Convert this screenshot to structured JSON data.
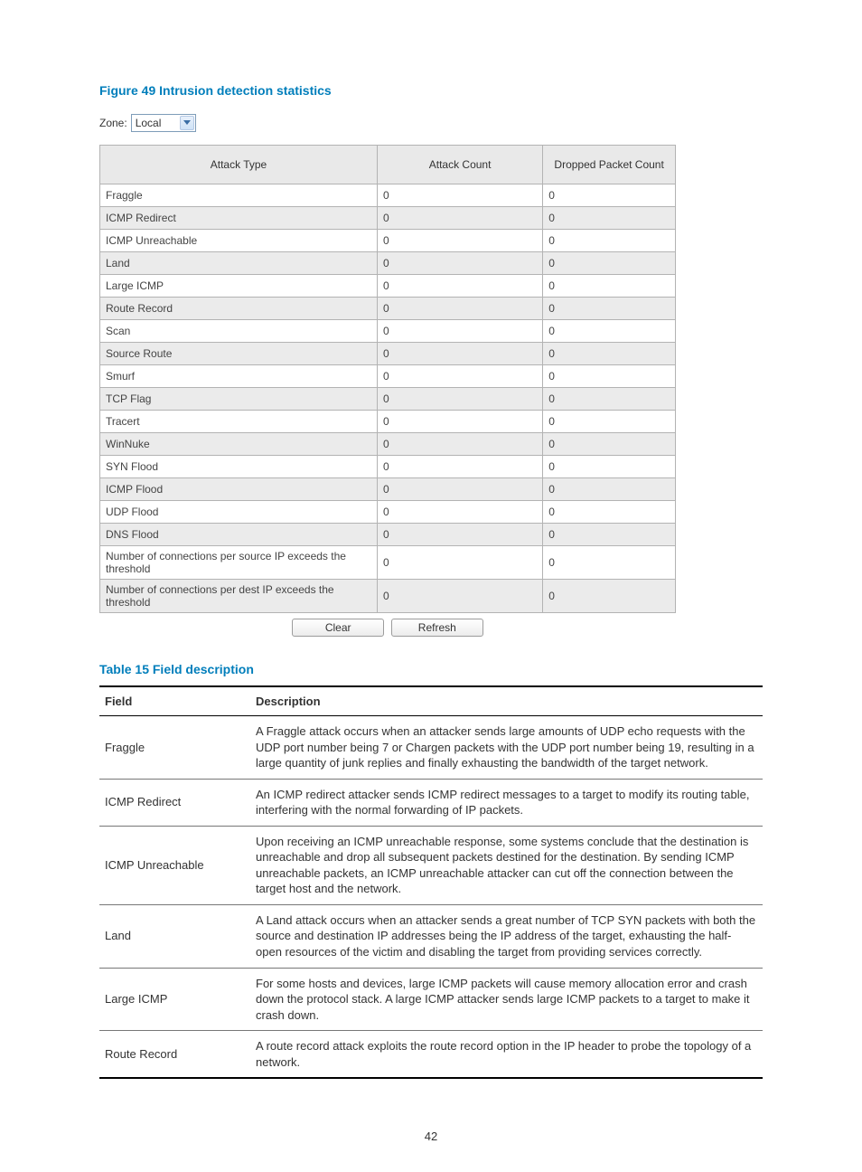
{
  "figure_title": "Figure 49 Intrusion detection statistics",
  "zone_label": "Zone:",
  "zone_value": "Local",
  "stats_headers": {
    "type": "Attack Type",
    "count": "Attack Count",
    "drop": "Dropped Packet Count"
  },
  "stats_rows": [
    {
      "type": "Fraggle",
      "count": "0",
      "drop": "0"
    },
    {
      "type": "ICMP Redirect",
      "count": "0",
      "drop": "0"
    },
    {
      "type": "ICMP Unreachable",
      "count": "0",
      "drop": "0"
    },
    {
      "type": "Land",
      "count": "0",
      "drop": "0"
    },
    {
      "type": "Large ICMP",
      "count": "0",
      "drop": "0"
    },
    {
      "type": "Route Record",
      "count": "0",
      "drop": "0"
    },
    {
      "type": "Scan",
      "count": "0",
      "drop": "0"
    },
    {
      "type": "Source Route",
      "count": "0",
      "drop": "0"
    },
    {
      "type": "Smurf",
      "count": "0",
      "drop": "0"
    },
    {
      "type": "TCP Flag",
      "count": "0",
      "drop": "0"
    },
    {
      "type": "Tracert",
      "count": "0",
      "drop": "0"
    },
    {
      "type": "WinNuke",
      "count": "0",
      "drop": "0"
    },
    {
      "type": "SYN Flood",
      "count": "0",
      "drop": "0"
    },
    {
      "type": "ICMP Flood",
      "count": "0",
      "drop": "0"
    },
    {
      "type": "UDP Flood",
      "count": "0",
      "drop": "0"
    },
    {
      "type": "DNS Flood",
      "count": "0",
      "drop": "0"
    },
    {
      "type": "Number of connections per source IP exceeds the threshold",
      "count": "0",
      "drop": "0"
    },
    {
      "type": "Number of connections per dest IP exceeds the threshold",
      "count": "0",
      "drop": "0"
    }
  ],
  "buttons": {
    "clear": "Clear",
    "refresh": "Refresh"
  },
  "table_title": "Table 15 Field description",
  "desc_headers": {
    "field": "Field",
    "desc": "Description"
  },
  "desc_rows": [
    {
      "field": "Fraggle",
      "desc": "A Fraggle attack occurs when an attacker sends large amounts of UDP echo requests with the UDP port number being 7 or Chargen packets with the UDP port number being 19, resulting in a large quantity of junk replies and finally exhausting the bandwidth of the target network."
    },
    {
      "field": "ICMP Redirect",
      "desc": "An ICMP redirect attacker sends ICMP redirect messages to a target to modify its routing table, interfering with the normal forwarding of IP packets."
    },
    {
      "field": "ICMP Unreachable",
      "desc": "Upon receiving an ICMP unreachable response, some systems conclude that the destination is unreachable and drop all subsequent packets destined for the destination. By sending ICMP unreachable packets, an ICMP unreachable attacker can cut off the connection between the target host and the network."
    },
    {
      "field": "Land",
      "desc": "A Land attack occurs when an attacker sends a great number of TCP SYN packets with both the source and destination IP addresses being the IP address of the target, exhausting the half-open resources of the victim and disabling the target from providing services correctly."
    },
    {
      "field": "Large ICMP",
      "desc": "For some hosts and devices, large ICMP packets will cause memory allocation error and crash down the protocol stack. A large ICMP attacker sends large ICMP packets to a target to make it crash down."
    },
    {
      "field": "Route Record",
      "desc": "A route record attack exploits the route record option in the IP header to probe the topology of a network."
    }
  ],
  "page_number": "42"
}
